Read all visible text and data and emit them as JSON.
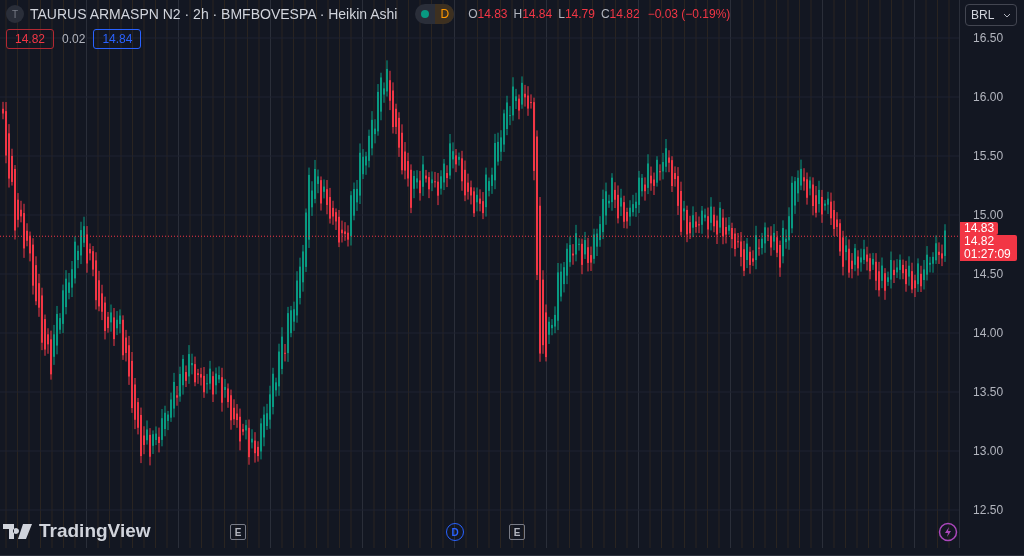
{
  "header": {
    "symbol_initial": "T",
    "title": "TAURUS ARMASPN N2 · 2h · BMFBOVESPA · Heikin Ashi",
    "market_status": {
      "letter": "D",
      "open": true
    },
    "falling": true,
    "ohlc": [
      {
        "label": "O",
        "value": "14.83"
      },
      {
        "label": "H",
        "value": "14.84"
      },
      {
        "label": "L",
        "value": "14.79"
      },
      {
        "label": "C",
        "value": "14.82"
      }
    ],
    "change": "−0.03 (−0.19%)"
  },
  "quotes": {
    "bid": "14.82",
    "spread": "0.02",
    "ask": "14.84"
  },
  "currency": "BRL",
  "price_axis": {
    "ticks": [
      "16.50",
      "16.00",
      "15.50",
      "15.00",
      "14.50",
      "14.00",
      "13.50",
      "13.00",
      "12.50"
    ]
  },
  "price_tags": [
    {
      "price": "14.83"
    },
    {
      "price": "14.82",
      "countdown": "01:27:09"
    }
  ],
  "brand": "TradingView",
  "events": [
    {
      "kind": "earnings",
      "letter": "E"
    },
    {
      "kind": "dividend",
      "letter": "D"
    },
    {
      "kind": "earnings",
      "letter": "E"
    },
    {
      "kind": "flash"
    }
  ]
}
